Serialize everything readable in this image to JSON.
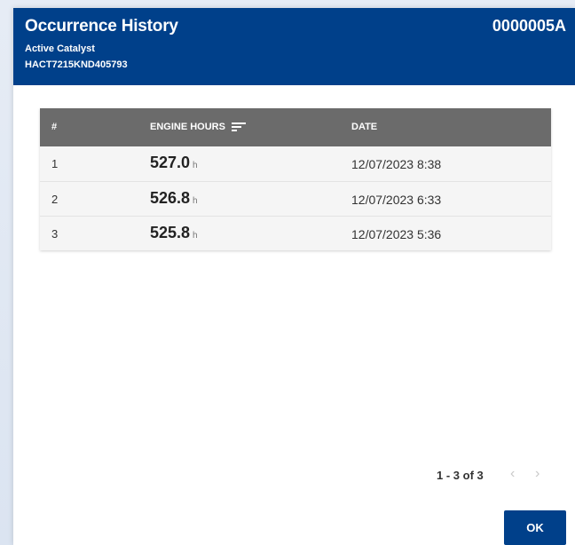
{
  "dialog": {
    "title": "Occurrence History",
    "subtitle": "Active Catalyst",
    "serial": "HACT7215KND405793",
    "code": "0000005A"
  },
  "table": {
    "headers": [
      "#",
      "ENGINE HOURS",
      "DATE"
    ],
    "rows": [
      {
        "index": "1",
        "hours": "527.0",
        "unit": "h",
        "date": "12/07/2023 8:38"
      },
      {
        "index": "2",
        "hours": "526.8",
        "unit": "h",
        "date": "12/07/2023 6:33"
      },
      {
        "index": "3",
        "hours": "525.8",
        "unit": "h",
        "date": "12/07/2023 5:36"
      }
    ]
  },
  "pagination": {
    "label": "1 - 3 of 3",
    "prev_icon": "chevron-left-icon",
    "next_icon": "chevron-right-icon"
  },
  "actions": {
    "ok_label": "OK"
  },
  "colors": {
    "header_bg": "#00408a",
    "table_header_bg": "#6b6b6b",
    "primary_button": "#00408a"
  }
}
